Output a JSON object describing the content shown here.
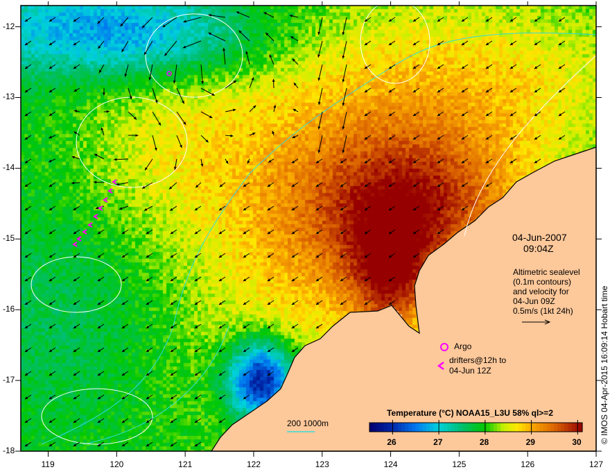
{
  "map": {
    "lon_range": [
      118.6,
      127.0
    ],
    "lat_range": [
      -18.0,
      -11.7
    ],
    "lon_ticks": [
      "119",
      "120",
      "121",
      "122",
      "123",
      "124",
      "125",
      "126",
      "127"
    ],
    "lat_ticks": [
      "-12",
      "-13",
      "-14",
      "-15",
      "-16",
      "-17",
      "-18"
    ],
    "land_color": "#fdc89a",
    "contour_color": "#ffffff",
    "isobath_color": "#33dddd"
  },
  "annotations": {
    "date": "04-Jun-2007",
    "time": "09:04Z",
    "legend_lines": [
      "Altimetric sealevel",
      "(0.1m contours)",
      "and velocity for",
      "04-Jun 09Z",
      "0.5m/s (1kt 24h)"
    ],
    "argo_label": "Argo",
    "drifters_line1": "drifters@12h to",
    "drifters_line2": "04-Jun 12Z",
    "isobath_label": "200  1000m",
    "marker_color": "#ff00ff",
    "credit": "© IMOS 04-Apr-2015 16:09:14 Hobart time"
  },
  "colorbar": {
    "title": "Temperature (°C) NOAA15_L3U 58% ql>=2",
    "range": [
      25.5,
      30.1
    ],
    "ticks": [
      "26",
      "27",
      "28",
      "29",
      "30"
    ]
  }
}
